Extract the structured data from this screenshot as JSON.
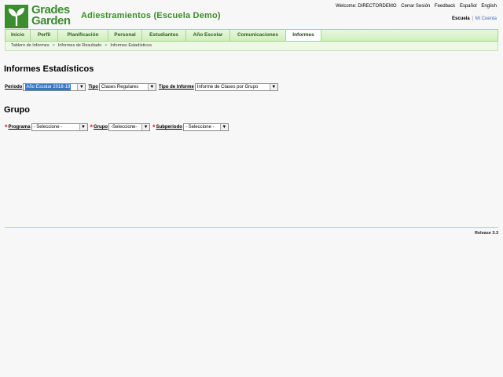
{
  "header": {
    "logo": {
      "line1": "Grades",
      "line2": "Garden"
    },
    "title": "Adiestramientos (Escuela Demo)",
    "top_links": {
      "welcome": "Welcome: DIRECTORDEMO",
      "logout": "Cerrar Sesión",
      "feedback": "Feedback",
      "spanish": "Español",
      "english": "English"
    },
    "school_links": {
      "school": "Escuela",
      "separator": "|",
      "my_account": "Mi Cuenta"
    }
  },
  "nav": {
    "tabs": [
      {
        "label": "Inicio"
      },
      {
        "label": "Perfil"
      },
      {
        "label": "Planificación"
      },
      {
        "label": "Personal"
      },
      {
        "label": "Estudiantes"
      },
      {
        "label": "Año Escolar"
      },
      {
        "label": "Comunicaciones"
      },
      {
        "label": "Informes"
      }
    ],
    "active_tab": "Informes"
  },
  "breadcrumb": [
    "Tablero de Informes",
    "Informes de Resultado",
    "Informes Estadísticos"
  ],
  "breadcrumb_separator": ">",
  "main": {
    "title": "Informes Estadísticos",
    "filters": {
      "periodo": {
        "label": "Periodo",
        "value": "Año Escolar 2018-19"
      },
      "tipo": {
        "label": "Tipo",
        "value": "Clases Regulares"
      },
      "tipo_informe": {
        "label": "Tipo de Informe",
        "value": "Informe de Clases por Grupo"
      }
    },
    "group_section": {
      "title": "Grupo",
      "required_mark": "*",
      "programa": {
        "label": "Programa",
        "value": "- Seleccione -"
      },
      "grupo": {
        "label": "Grupo",
        "value": "-Seleccione-"
      },
      "subperiodo": {
        "label": "Subperiodo",
        "value": "- Seleccione -"
      }
    }
  },
  "footer": {
    "release": "Release 3.3"
  },
  "colors": {
    "brand_green": "#3c8d2f",
    "nav_bg": "#cfeebc",
    "link_blue": "#3c6fb5",
    "required_red": "#d22222"
  },
  "icons": {
    "caret": "chevron-down-icon",
    "logo": "sprout-icon"
  }
}
